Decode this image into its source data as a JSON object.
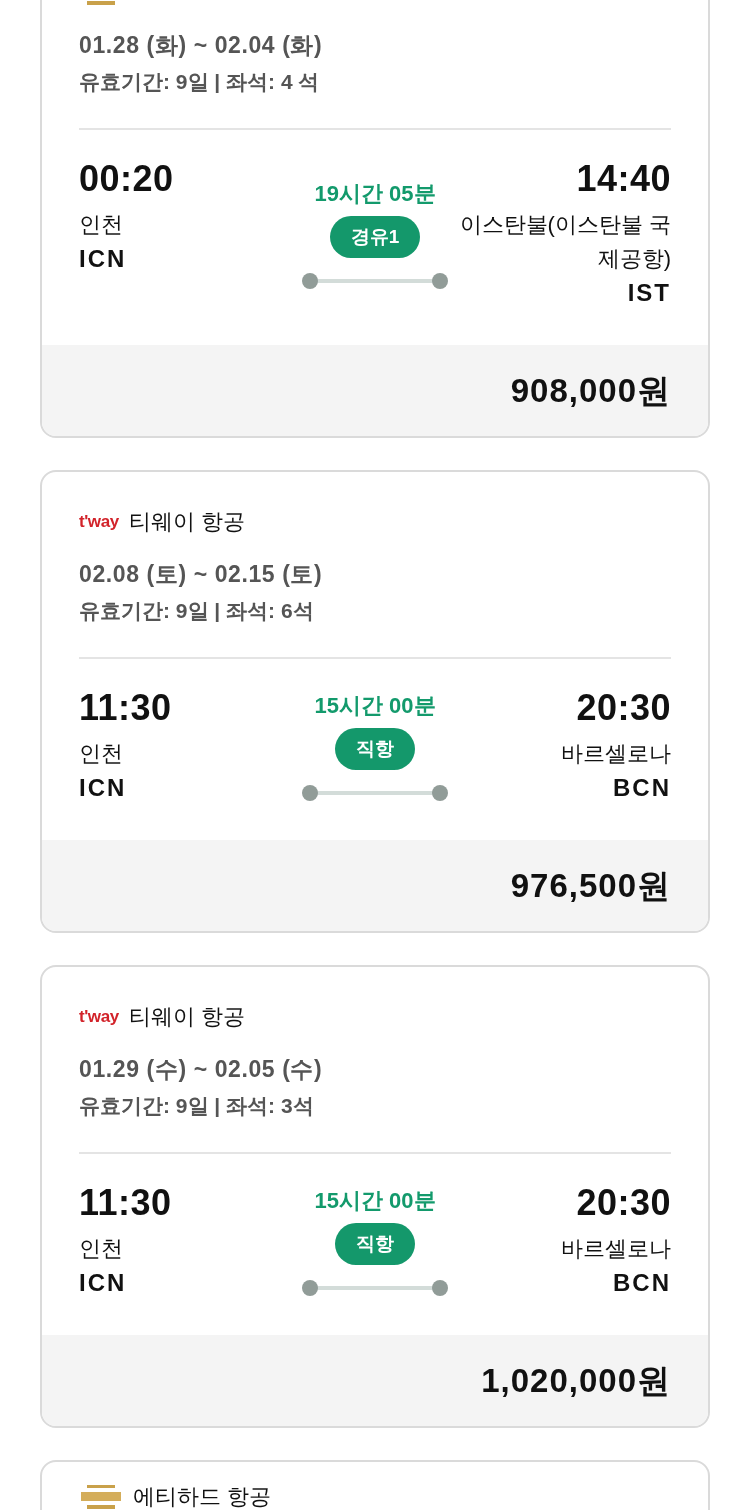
{
  "cards": [
    {
      "airline": {
        "logo": {
          "kind": "crest"
        }
      },
      "dates": "01.28 (화) ~ 02.04 (화)",
      "validity": "유효기간: 9일 **|** 좌석: 4 석",
      "departure": {
        "time": "00:20",
        "city": "인천",
        "code": "ICN"
      },
      "duration": "19시간 05분",
      "stop_label": "경유1",
      "arrival": {
        "time": "14:40",
        "city": "이스탄불(이스탄불 국제공항)",
        "code": "IST"
      },
      "price": "908,000원"
    },
    {
      "airline": {
        "logo": {
          "kind": "wordmark",
          "text": "t'way"
        },
        "name": "티웨이 항공"
      },
      "dates": "02.08 (토) ~ 02.15 (토)",
      "validity": "유효기간: 9일 **|** 좌석: 6석",
      "departure": {
        "time": "11:30",
        "city": "인천",
        "code": "ICN"
      },
      "duration": "15시간 00분",
      "stop_label": "직항",
      "arrival": {
        "time": "20:30",
        "city": "바르셀로나",
        "code": "BCN"
      },
      "price": "976,500원"
    },
    {
      "airline": {
        "logo": {
          "kind": "wordmark",
          "text": "t'way"
        },
        "name": "티웨이 항공"
      },
      "dates": "01.29 (수) ~ 02.05 (수)",
      "validity": "유효기간: 9일 **|** 좌석: 3석",
      "departure": {
        "time": "11:30",
        "city": "인천",
        "code": "ICN"
      },
      "duration": "15시간 00분",
      "stop_label": "직항",
      "arrival": {
        "time": "20:30",
        "city": "바르셀로나",
        "code": "BCN"
      },
      "price": "1,020,000원"
    },
    {
      "airline": {
        "logo": {
          "kind": "crest"
        },
        "name": "에티하드 항공"
      }
    }
  ]
}
